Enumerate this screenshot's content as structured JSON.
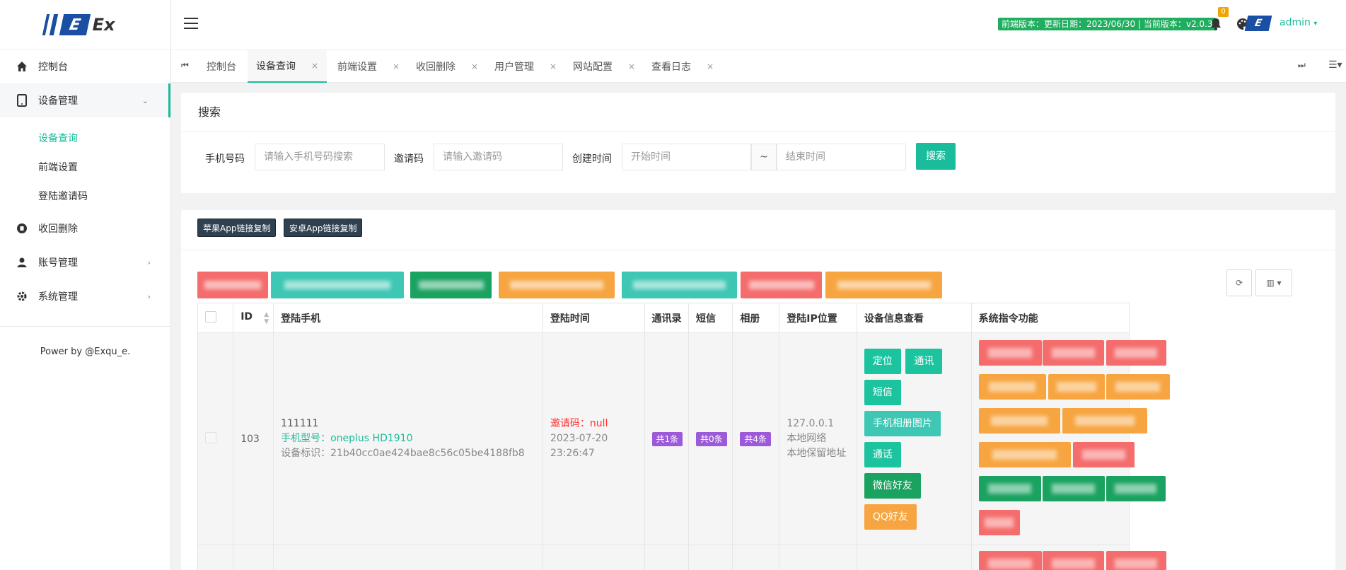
{
  "brand": {
    "logo_letter": "E",
    "logo_text": "Ex"
  },
  "sidebar": {
    "items": [
      {
        "label": "控制台",
        "icon": "home-icon"
      },
      {
        "label": "设备管理",
        "icon": "tablet-icon"
      },
      {
        "label": "收回删除",
        "icon": "recycle-icon"
      },
      {
        "label": "账号管理",
        "icon": "user-icon"
      },
      {
        "label": "系统管理",
        "icon": "gear-icon"
      }
    ],
    "device_sub": [
      "设备查询",
      "前端设置",
      "登陆邀请码"
    ],
    "footer": "Power by @Exqu_e."
  },
  "header": {
    "version": "前端版本：更新日期：2023/06/30 | 当前版本：v2.0.3",
    "notify_count": "0",
    "user": "admin"
  },
  "tabs": [
    {
      "label": "控制台",
      "closable": false
    },
    {
      "label": "设备查询",
      "closable": true
    },
    {
      "label": "前端设置",
      "closable": true
    },
    {
      "label": "收回删除",
      "closable": true
    },
    {
      "label": "用户管理",
      "closable": true
    },
    {
      "label": "网站配置",
      "closable": true
    },
    {
      "label": "查看日志",
      "closable": true
    }
  ],
  "search": {
    "title": "搜索",
    "phone_label": "手机号码",
    "phone_placeholder": "请输入手机号码搜索",
    "invite_label": "邀请码",
    "invite_placeholder": "请输入邀请码",
    "time_label": "创建时间",
    "start_placeholder": "开始时间",
    "tilde": "~",
    "end_placeholder": "结束时间",
    "button": "搜索"
  },
  "toolbar": {
    "copy_ios": "苹果App链接复制",
    "copy_android": "安卓App链接复制",
    "refresh": "⟳",
    "columns": "▥ ▾"
  },
  "table": {
    "headers": [
      "ID",
      "登陆手机",
      "登陆时间",
      "通讯录",
      "短信",
      "相册",
      "登陆IP位置",
      "设备信息查看",
      "系统指令功能"
    ],
    "row": {
      "id": "103",
      "phone": "111111",
      "model": "手机型号：oneplus HD1910",
      "device": "设备标识：21b40cc0ae424bae8c56c05be4188fb8",
      "invite": "邀请码：null",
      "time": "2023-07-20 23:26:47",
      "contacts": "共1条",
      "sms": "共0条",
      "album": "共4条",
      "ip": "127.0.0.1",
      "ip_net": "本地网络",
      "ip_addr": "本地保留地址"
    },
    "actions": {
      "locate": "定位",
      "calls": "通讯",
      "sms": "短信",
      "photos": "手机相册图片",
      "call_log": "通话",
      "wechat": "微信好友",
      "qq": "QQ好友"
    }
  },
  "colors": {
    "accent": "#1abc9c",
    "red": "#f56c6c",
    "orange": "#f7a540",
    "teal": "#3ec7b4",
    "green": "#1aa260",
    "purple": "#9c59d8",
    "dark": "#2f4050"
  }
}
